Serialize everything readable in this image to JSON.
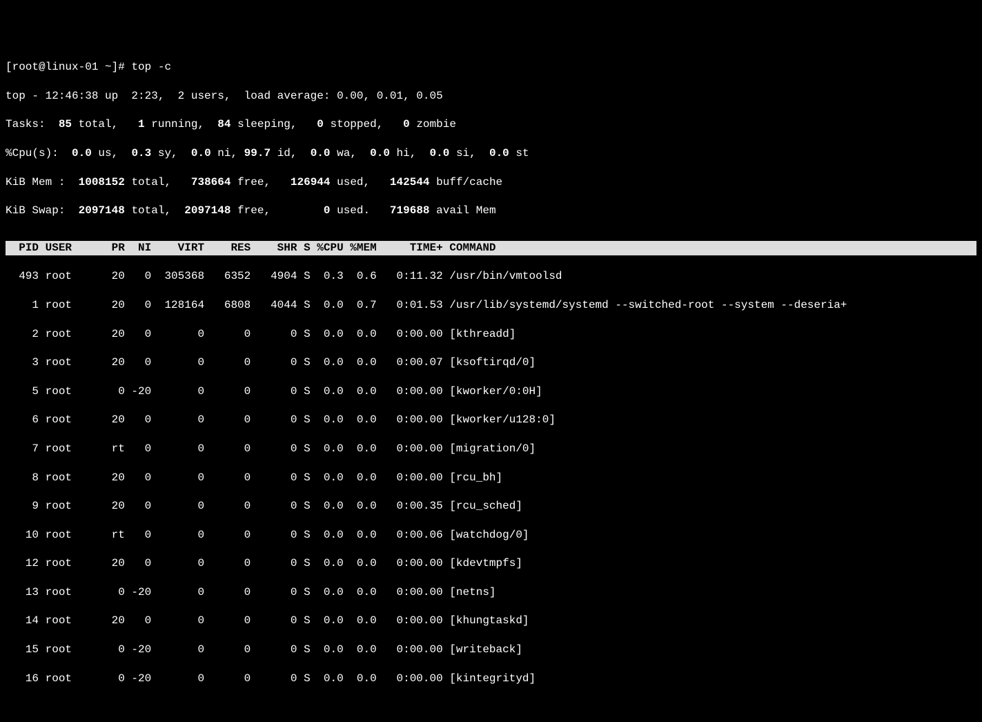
{
  "prompt": "[root@linux-01 ~]# ",
  "cmd": "top -c",
  "summary": {
    "line1_a": "top - 12:46:38 up  2:23,  2 users,  load average: 0.00, 0.01, 0.05",
    "line2_label1": "Tasks: ",
    "line2_v1": " 85 ",
    "line2_label2": "total,   ",
    "line2_v2": "1 ",
    "line2_label3": "running,  ",
    "line2_v3": "84 ",
    "line2_label4": "sleeping,   ",
    "line2_v4": "0 ",
    "line2_label5": "stopped,   ",
    "line2_v5": "0 ",
    "line2_label6": "zombie",
    "line3_label1": "%Cpu(s):  ",
    "line3_v1": "0.0 ",
    "line3_label2": "us,  ",
    "line3_v2": "0.3 ",
    "line3_label3": "sy,  ",
    "line3_v3": "0.0 ",
    "line3_label4": "ni, ",
    "line3_v4": "99.7 ",
    "line3_label5": "id,  ",
    "line3_v5": "0.0 ",
    "line3_label6": "wa,  ",
    "line3_v6": "0.0 ",
    "line3_label7": "hi,  ",
    "line3_v7": "0.0 ",
    "line3_label8": "si,  ",
    "line3_v8": "0.0 ",
    "line3_label9": "st",
    "line4_label1": "KiB Mem : ",
    "line4_v1": " 1008152 ",
    "line4_label2": "total,   ",
    "line4_v2": "738664 ",
    "line4_label3": "free,   ",
    "line4_v3": "126944 ",
    "line4_label4": "used,   ",
    "line4_v4": "142544 ",
    "line4_label5": "buff/cache",
    "line5_label1": "KiB Swap: ",
    "line5_v1": " 2097148 ",
    "line5_label2": "total,  ",
    "line5_v2": "2097148 ",
    "line5_label3": "free,        ",
    "line5_v3": "0 ",
    "line5_label4": "used.   ",
    "line5_v4": "719688 ",
    "line5_label5": "avail Mem"
  },
  "header": "  PID USER      PR  NI    VIRT    RES    SHR S %CPU %MEM     TIME+ COMMAND                                                                 ",
  "rows": [
    "  493 root      20   0  305368   6352   4904 S  0.3  0.6   0:11.32 /usr/bin/vmtoolsd",
    "    1 root      20   0  128164   6808   4044 S  0.0  0.7   0:01.53 /usr/lib/systemd/systemd --switched-root --system --deseria+",
    "    2 root      20   0       0      0      0 S  0.0  0.0   0:00.00 [kthreadd]",
    "    3 root      20   0       0      0      0 S  0.0  0.0   0:00.07 [ksoftirqd/0]",
    "    5 root       0 -20       0      0      0 S  0.0  0.0   0:00.00 [kworker/0:0H]",
    "    6 root      20   0       0      0      0 S  0.0  0.0   0:00.00 [kworker/u128:0]",
    "    7 root      rt   0       0      0      0 S  0.0  0.0   0:00.00 [migration/0]",
    "    8 root      20   0       0      0      0 S  0.0  0.0   0:00.00 [rcu_bh]",
    "    9 root      20   0       0      0      0 S  0.0  0.0   0:00.35 [rcu_sched]",
    "   10 root      rt   0       0      0      0 S  0.0  0.0   0:00.06 [watchdog/0]",
    "   12 root      20   0       0      0      0 S  0.0  0.0   0:00.00 [kdevtmpfs]",
    "   13 root       0 -20       0      0      0 S  0.0  0.0   0:00.00 [netns]",
    "   14 root      20   0       0      0      0 S  0.0  0.0   0:00.00 [khungtaskd]",
    "   15 root       0 -20       0      0      0 S  0.0  0.0   0:00.00 [writeback]",
    "   16 root       0 -20       0      0      0 S  0.0  0.0   0:00.00 [kintegrityd]"
  ]
}
